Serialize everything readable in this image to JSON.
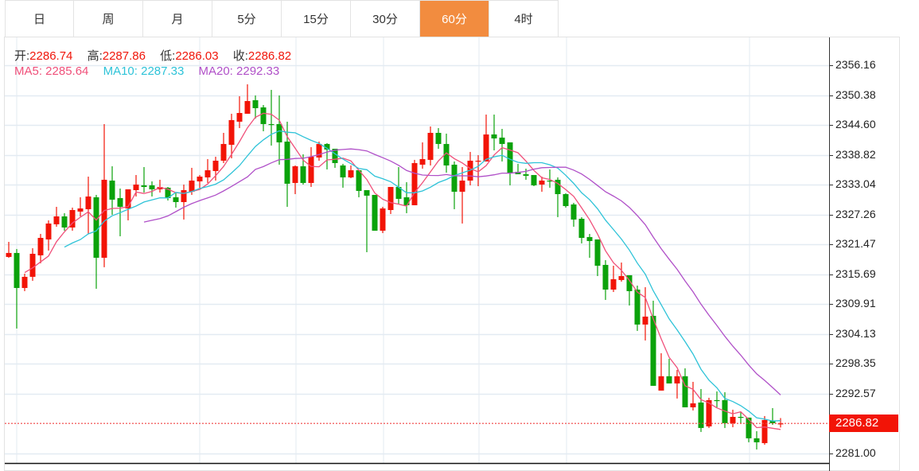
{
  "tabs": [
    {
      "label": "日",
      "active": false
    },
    {
      "label": "周",
      "active": false
    },
    {
      "label": "月",
      "active": false
    },
    {
      "label": "5分",
      "active": false
    },
    {
      "label": "15分",
      "active": false
    },
    {
      "label": "30分",
      "active": false
    },
    {
      "label": "60分",
      "active": true
    },
    {
      "label": "4时",
      "active": false
    }
  ],
  "ohlc": {
    "open_label": "开:",
    "open": "2286.74",
    "high_label": "高:",
    "high": "2287.86",
    "low_label": "低:",
    "low": "2286.03",
    "close_label": "收:",
    "close": "2286.82"
  },
  "ma": {
    "ma5": "MA5: 2285.64",
    "ma10": "MA10: 2287.33",
    "ma20": "MA20: 2292.33"
  },
  "colors": {
    "up": "#f21407",
    "down": "#0ba20b",
    "ma5": "#f0507a",
    "ma10": "#2ec3d8",
    "ma20": "#b050c8",
    "active_tab": "#f28c3f"
  },
  "current_price": "2286.82",
  "chart_data": {
    "type": "candlestick",
    "y_ticks": [
      "2356.16",
      "2350.38",
      "2344.60",
      "2338.82",
      "2333.04",
      "2327.26",
      "2321.47",
      "2315.69",
      "2309.91",
      "2304.13",
      "2298.35",
      "2292.57",
      "2281.00"
    ],
    "ylim": [
      2281.0,
      2356.16
    ],
    "candles_ohlc": [
      [
        2319.05,
        2321.97,
        2318.89,
        2319.82
      ],
      [
        2319.82,
        2320.59,
        2305.19,
        2313.04
      ],
      [
        2313.04,
        2315.81,
        2312.43,
        2315.2
      ],
      [
        2315.2,
        2320.74,
        2314.43,
        2319.66
      ],
      [
        2319.36,
        2323.51,
        2317.82,
        2322.74
      ],
      [
        2322.44,
        2326.13,
        2320.28,
        2325.52
      ],
      [
        2325.37,
        2328.75,
        2324.9,
        2326.9
      ],
      [
        2326.9,
        2327.52,
        2324.13,
        2324.75
      ],
      [
        2324.75,
        2328.6,
        2324.13,
        2328.13
      ],
      [
        2327.83,
        2330.6,
        2326.9,
        2328.44
      ],
      [
        2328.29,
        2334.6,
        2323.51,
        2330.75
      ],
      [
        2330.6,
        2331.06,
        2312.89,
        2318.89
      ],
      [
        2318.89,
        2344.77,
        2317.05,
        2333.99
      ],
      [
        2333.83,
        2336.6,
        2327.21,
        2330.14
      ],
      [
        2330.44,
        2332.29,
        2323.05,
        2328.75
      ],
      [
        2328.44,
        2332.14,
        2326.13,
        2332.14
      ],
      [
        2331.98,
        2334.91,
        2330.75,
        2333.06
      ],
      [
        2332.91,
        2336.45,
        2331.52,
        2332.6
      ],
      [
        2332.91,
        2333.68,
        2330.75,
        2332.14
      ],
      [
        2332.14,
        2333.99,
        2331.52,
        2332.6
      ],
      [
        2332.45,
        2332.6,
        2329.98,
        2330.44
      ],
      [
        2330.6,
        2331.37,
        2328.6,
        2329.67
      ],
      [
        2329.67,
        2333.06,
        2326.29,
        2331.98
      ],
      [
        2331.67,
        2336.3,
        2331.06,
        2333.83
      ],
      [
        2333.68,
        2334.91,
        2332.29,
        2334.6
      ],
      [
        2334.45,
        2337.99,
        2333.37,
        2335.83
      ],
      [
        2335.68,
        2338.45,
        2333.83,
        2337.68
      ],
      [
        2337.68,
        2343.07,
        2337.22,
        2340.92
      ],
      [
        2340.76,
        2346.77,
        2338.14,
        2345.54
      ],
      [
        2345.23,
        2350.16,
        2343.99,
        2346.92
      ],
      [
        2346.77,
        2352.47,
        2346.77,
        2349.23
      ],
      [
        2349.39,
        2350.31,
        2345.84,
        2347.85
      ],
      [
        2348.0,
        2348.46,
        2343.38,
        2344.77
      ],
      [
        2344.77,
        2351.39,
        2340.61,
        2344.61
      ],
      [
        2344.77,
        2350.31,
        2336.91,
        2341.23
      ],
      [
        2341.38,
        2345.23,
        2328.75,
        2333.22
      ],
      [
        2333.37,
        2336.76,
        2331.21,
        2336.6
      ],
      [
        2336.6,
        2338.91,
        2333.06,
        2333.37
      ],
      [
        2333.37,
        2340.3,
        2332.6,
        2338.45
      ],
      [
        2338.3,
        2341.38,
        2337.68,
        2340.92
      ],
      [
        2340.92,
        2341.07,
        2335.99,
        2339.84
      ],
      [
        2339.99,
        2339.99,
        2336.3,
        2337.22
      ],
      [
        2336.76,
        2337.07,
        2332.45,
        2334.45
      ],
      [
        2334.45,
        2336.76,
        2334.29,
        2335.83
      ],
      [
        2335.83,
        2335.83,
        2330.6,
        2331.83
      ],
      [
        2331.98,
        2331.98,
        2319.97,
        2330.91
      ],
      [
        2331.06,
        2331.06,
        2324.13,
        2324.13
      ],
      [
        2324.13,
        2328.75,
        2323.67,
        2328.44
      ],
      [
        2328.13,
        2332.6,
        2327.36,
        2332.6
      ],
      [
        2332.6,
        2336.45,
        2329.21,
        2330.29
      ],
      [
        2330.6,
        2333.52,
        2327.52,
        2329.06
      ],
      [
        2329.06,
        2337.84,
        2329.06,
        2337.22
      ],
      [
        2336.91,
        2341.23,
        2336.14,
        2337.99
      ],
      [
        2337.84,
        2344.3,
        2336.76,
        2343.07
      ],
      [
        2343.07,
        2343.99,
        2339.99,
        2340.92
      ],
      [
        2340.92,
        2342.92,
        2335.37,
        2336.76
      ],
      [
        2336.91,
        2337.53,
        2328.29,
        2331.67
      ],
      [
        2331.67,
        2336.45,
        2325.52,
        2333.83
      ],
      [
        2333.83,
        2339.38,
        2332.91,
        2337.68
      ],
      [
        2337.53,
        2338.76,
        2332.75,
        2337.68
      ],
      [
        2337.53,
        2346.61,
        2337.53,
        2342.76
      ],
      [
        2342.76,
        2346.61,
        2339.68,
        2341.99
      ],
      [
        2342.15,
        2343.84,
        2337.53,
        2340.92
      ],
      [
        2341.23,
        2341.23,
        2332.91,
        2335.37
      ],
      [
        2335.53,
        2337.07,
        2335.06,
        2335.06
      ],
      [
        2335.06,
        2336.14,
        2333.99,
        2334.76
      ],
      [
        2334.91,
        2334.91,
        2332.75,
        2332.91
      ],
      [
        2333.06,
        2334.6,
        2331.67,
        2333.83
      ],
      [
        2333.83,
        2335.99,
        2332.45,
        2333.68
      ],
      [
        2333.99,
        2334.45,
        2326.75,
        2331.21
      ],
      [
        2331.21,
        2331.37,
        2328.6,
        2328.9
      ],
      [
        2329.21,
        2329.52,
        2324.9,
        2326.29
      ],
      [
        2326.44,
        2326.75,
        2321.67,
        2322.74
      ],
      [
        2322.9,
        2323.51,
        2318.89,
        2322.13
      ],
      [
        2322.44,
        2322.44,
        2315.35,
        2317.35
      ],
      [
        2317.51,
        2318.43,
        2310.73,
        2312.73
      ],
      [
        2312.73,
        2317.35,
        2312.27,
        2314.74
      ],
      [
        2314.58,
        2317.97,
        2314.27,
        2315.35
      ],
      [
        2315.51,
        2315.51,
        2309.65,
        2312.43
      ],
      [
        2312.73,
        2313.5,
        2304.73,
        2305.96
      ],
      [
        2305.96,
        2313.2,
        2302.88,
        2307.5
      ],
      [
        2307.65,
        2310.58,
        2294.1,
        2294.1
      ],
      [
        2293.18,
        2300.41,
        2293.18,
        2295.95
      ],
      [
        2295.95,
        2299.34,
        2294.56,
        2294.56
      ],
      [
        2294.56,
        2297.18,
        2291.64,
        2295.95
      ],
      [
        2295.95,
        2297.49,
        2289.94,
        2289.94
      ],
      [
        2289.94,
        2294.87,
        2289.33,
        2290.71
      ],
      [
        2290.87,
        2293.48,
        2285.17,
        2285.94
      ],
      [
        2286.25,
        2291.79,
        2285.94,
        2291.33
      ],
      [
        2291.33,
        2293.02,
        2289.94,
        2291.17
      ],
      [
        2291.33,
        2292.87,
        2285.94,
        2286.86
      ],
      [
        2286.86,
        2289.48,
        2286.09,
        2288.09
      ],
      [
        2288.09,
        2289.02,
        2286.86,
        2287.94
      ],
      [
        2287.94,
        2287.94,
        2283.17,
        2283.94
      ],
      [
        2283.94,
        2285.32,
        2281.78,
        2283.17
      ],
      [
        2283.01,
        2288.25,
        2282.7,
        2287.48
      ],
      [
        2287.32,
        2289.79,
        2286.55,
        2286.86
      ],
      [
        2286.74,
        2287.86,
        2286.03,
        2286.82
      ]
    ],
    "moving_averages": [
      "MA5",
      "MA10",
      "MA20"
    ]
  }
}
